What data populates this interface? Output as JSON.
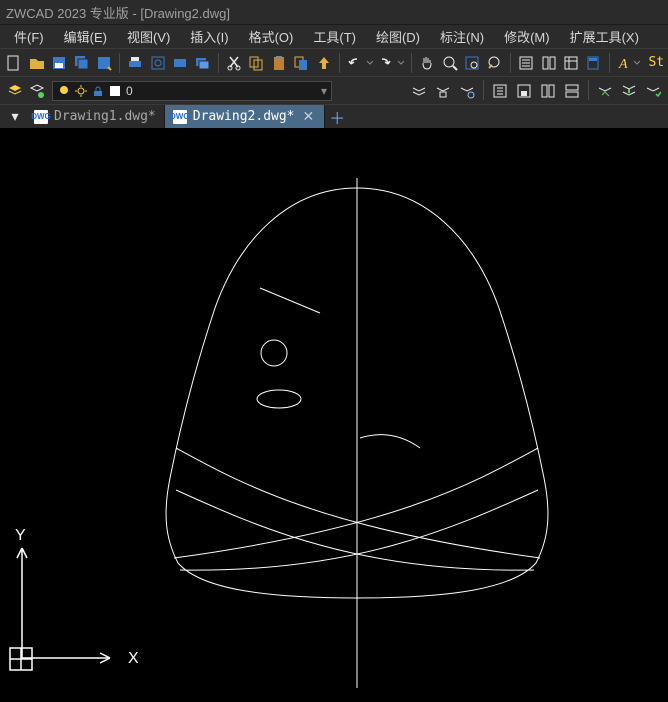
{
  "title": "ZWCAD 2023 专业版 - [Drawing2.dwg]",
  "menu": {
    "file": "件(F)",
    "edit": "编辑(E)",
    "view": "视图(V)",
    "insert": "插入(I)",
    "format": "格式(O)",
    "tools": "工具(T)",
    "draw": "绘图(D)",
    "dimension": "标注(N)",
    "modify": "修改(M)",
    "extension": "扩展工具(X)"
  },
  "layer": {
    "current": "0"
  },
  "tabs": {
    "items": [
      {
        "label": "Drawing1.dwg*",
        "active": false,
        "icon": "DWG"
      },
      {
        "label": "Drawing2.dwg*",
        "active": true,
        "icon": "DWG"
      }
    ]
  },
  "status_right": "St",
  "axis": {
    "x": "X",
    "y": "Y"
  }
}
